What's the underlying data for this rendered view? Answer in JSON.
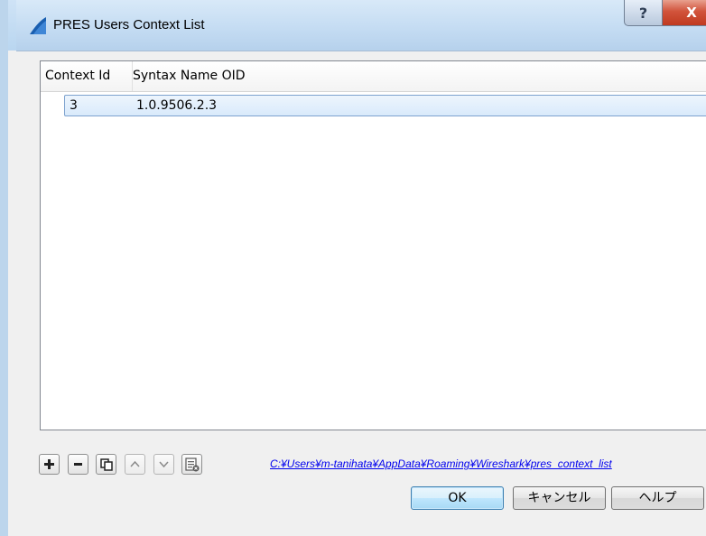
{
  "window": {
    "title": "PRES Users Context List",
    "help_glyph": "?",
    "close_glyph": "X"
  },
  "table": {
    "columns": [
      "Context Id",
      "Syntax Name OID"
    ],
    "rows": [
      {
        "context_id": "3",
        "syntax_name_oid": "1.0.9506.2.3"
      }
    ]
  },
  "toolbar": {
    "buttons": [
      {
        "name": "add-button",
        "icon": "plus-icon",
        "enabled": true
      },
      {
        "name": "remove-button",
        "icon": "minus-icon",
        "enabled": true
      },
      {
        "name": "copy-button",
        "icon": "copy-icon",
        "enabled": true
      },
      {
        "name": "move-up-button",
        "icon": "chevron-up-icon",
        "enabled": false
      },
      {
        "name": "move-down-button",
        "icon": "chevron-down-icon",
        "enabled": false
      },
      {
        "name": "clear-button",
        "icon": "clear-list-icon",
        "enabled": true
      }
    ],
    "file_path": "C:¥Users¥m-tanihata¥AppData¥Roaming¥Wireshark¥pres_context_list"
  },
  "buttons": {
    "ok": "OK",
    "cancel": "キャンセル",
    "help": "ヘルプ"
  },
  "colors": {
    "selection": "#d9eafb",
    "link": "#0000ee",
    "close_button": "#c8452a"
  }
}
